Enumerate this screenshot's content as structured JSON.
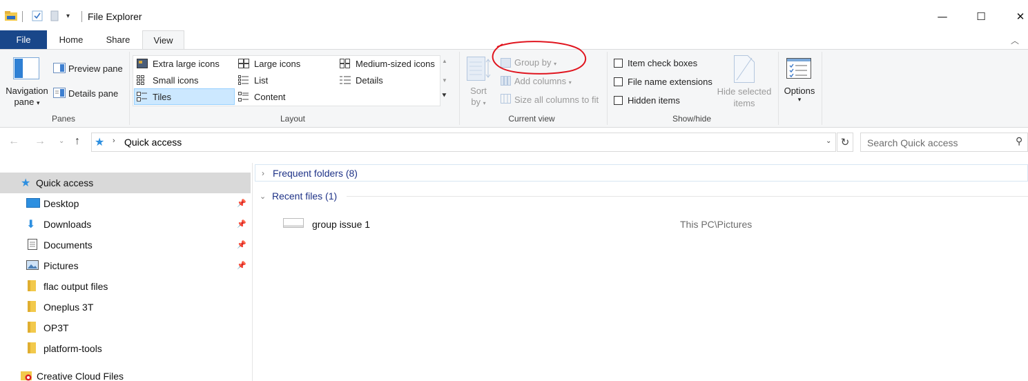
{
  "window": {
    "title": "File Explorer",
    "controls": {
      "minimize": "—",
      "maximize": "☐",
      "close": "✕"
    }
  },
  "tabs": [
    {
      "label": "File"
    },
    {
      "label": "Home"
    },
    {
      "label": "Share"
    },
    {
      "label": "View"
    }
  ],
  "ribbon": {
    "panes": {
      "navigation_pane": "Navigation pane",
      "preview_pane": "Preview pane",
      "details_pane": "Details pane",
      "group_label": "Panes"
    },
    "layout": {
      "items": [
        "Extra large icons",
        "Large icons",
        "Medium-sized icons",
        "Small icons",
        "List",
        "Details",
        "Tiles",
        "Content"
      ],
      "selected": "Tiles",
      "group_label": "Layout"
    },
    "current_view": {
      "sort_by": "Sort by",
      "group_by": "Group by",
      "add_columns": "Add columns",
      "size_all_columns": "Size all columns to fit",
      "group_label": "Current view"
    },
    "show_hide": {
      "item_check_boxes": "Item check boxes",
      "file_name_extensions": "File name extensions",
      "hidden_items": "Hidden items",
      "hide_selected_items": "Hide selected items",
      "group_label": "Show/hide"
    },
    "options": {
      "label": "Options"
    }
  },
  "address": {
    "path": "Quick access",
    "search_placeholder": "Search Quick access"
  },
  "nav": {
    "items": [
      {
        "label": "Quick access",
        "pinned": false
      },
      {
        "label": "Desktop",
        "pinned": true
      },
      {
        "label": "Downloads",
        "pinned": true
      },
      {
        "label": "Documents",
        "pinned": true
      },
      {
        "label": "Pictures",
        "pinned": true
      },
      {
        "label": "flac output files",
        "pinned": false
      },
      {
        "label": "Oneplus 3T",
        "pinned": false
      },
      {
        "label": "OP3T",
        "pinned": false
      },
      {
        "label": "platform-tools",
        "pinned": false
      },
      {
        "label": "Creative Cloud Files",
        "pinned": false
      }
    ]
  },
  "content": {
    "frequent_folders": "Frequent folders (8)",
    "recent_files": "Recent files (1)",
    "files": [
      {
        "name": "group issue 1",
        "location": "This PC\\Pictures"
      }
    ]
  },
  "colors": {
    "file_tab": "#19478a",
    "section_header": "#1e3287",
    "annotation_circle": "#e0141e",
    "selected_layout": "#cce8ff",
    "nav_selected": "#d9d9d9"
  }
}
